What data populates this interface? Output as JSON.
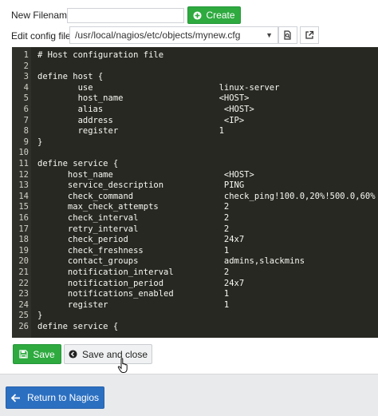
{
  "form": {
    "new_filename_label": "New Filename:",
    "new_filename_value": "",
    "create_label": "Create",
    "edit_config_label": "Edit config file:",
    "config_path": "/usr/local/nagios/etc/objects/mynew.cfg"
  },
  "editor": {
    "lines": [
      {
        "n": "1",
        "text": "# Host configuration file"
      },
      {
        "n": "2",
        "text": ""
      },
      {
        "n": "3",
        "text": "define host {"
      },
      {
        "n": "4",
        "text": "        use                         linux-server"
      },
      {
        "n": "5",
        "text": "        host_name                   <HOST>"
      },
      {
        "n": "6",
        "text": "        alias                        <HOST>"
      },
      {
        "n": "7",
        "text": "        address                      <IP>"
      },
      {
        "n": "8",
        "text": "        register                    1"
      },
      {
        "n": "9",
        "text": "}"
      },
      {
        "n": "10",
        "text": ""
      },
      {
        "n": "11",
        "text": "define service {"
      },
      {
        "n": "12",
        "text": "      host_name                      <HOST>"
      },
      {
        "n": "13",
        "text": "      service_description            PING"
      },
      {
        "n": "14",
        "text": "      check_command                  check_ping!100.0,20%!500.0,60%"
      },
      {
        "n": "15",
        "text": "      max_check_attempts             2"
      },
      {
        "n": "16",
        "text": "      check_interval                 2"
      },
      {
        "n": "17",
        "text": "      retry_interval                 2"
      },
      {
        "n": "18",
        "text": "      check_period                   24x7"
      },
      {
        "n": "19",
        "text": "      check_freshness                1"
      },
      {
        "n": "20",
        "text": "      contact_groups                 admins,slackmins"
      },
      {
        "n": "21",
        "text": "      notification_interval          2"
      },
      {
        "n": "22",
        "text": "      notification_period            24x7"
      },
      {
        "n": "23",
        "text": "      notifications_enabled          1"
      },
      {
        "n": "24",
        "text": "      register                       1"
      },
      {
        "n": "25",
        "text": "}"
      },
      {
        "n": "26",
        "text": "define service {"
      }
    ]
  },
  "actions": {
    "save_label": "Save",
    "save_close_label": "Save and close",
    "return_label": "Return to Nagios"
  },
  "colors": {
    "success": "#2eaa3f",
    "primary": "#2b6fc1",
    "editor_bg": "#272822"
  },
  "icons": {
    "create": "plus-circle-icon",
    "search": "search-file-icon",
    "open": "external-link-icon",
    "save": "floppy-disk-icon",
    "save_close": "arrow-circle-icon",
    "return": "arrow-left-icon"
  }
}
